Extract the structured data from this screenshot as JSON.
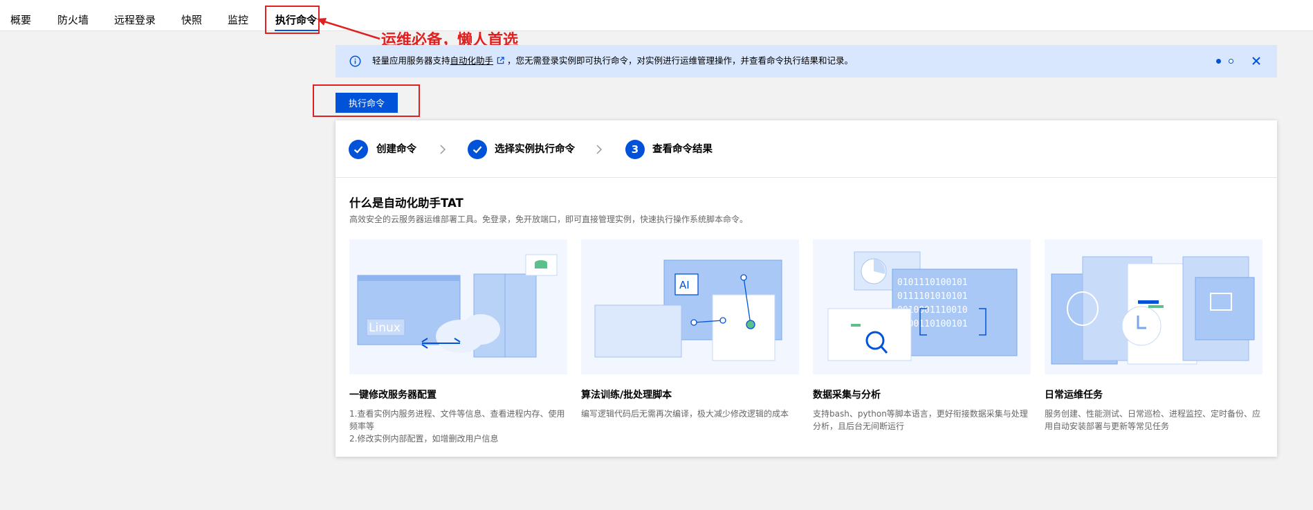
{
  "tabs": [
    {
      "label": "概要"
    },
    {
      "label": "防火墙"
    },
    {
      "label": "远程登录"
    },
    {
      "label": "快照"
    },
    {
      "label": "监控"
    },
    {
      "label": "执行命令"
    }
  ],
  "annotation": {
    "text": "运维必备，懒人首选"
  },
  "banner": {
    "text_before": "轻量应用服务器支持",
    "link_text": "自动化助手",
    "text_after": "，您无需登录实例即可执行命令，对实例进行运维管理操作，并查看命令执行结果和记录。"
  },
  "exec_button": {
    "label": "执行命令"
  },
  "steps": [
    {
      "label": "创建命令",
      "status": "done"
    },
    {
      "label": "选择实例执行命令",
      "status": "done"
    },
    {
      "label": "查看命令结果",
      "number": "3",
      "status": "current"
    }
  ],
  "section": {
    "title": "什么是自动化助手TAT",
    "desc": "高效安全的云服务器运维部署工具。免登录，免开放端口，即可直接管理实例，快速执行操作系统脚本命令。"
  },
  "features": [
    {
      "title": "一键修改服务器配置",
      "desc_lines": [
        "1.查看实例内服务进程、文件等信息、查看进程内存、使用频率等",
        "2.修改实例内部配置，如增删改用户信息"
      ],
      "illustration_text": "Linux"
    },
    {
      "title": "算法训练/批处理脚本",
      "desc_lines": [
        "编写逻辑代码后无需再次编译，极大减少修改逻辑的成本"
      ],
      "illustration_text": "AI"
    },
    {
      "title": "数据采集与分析",
      "desc_lines": [
        "支持bash、python等脚本语言，更好衔接数据采集与处理分析，且后台无间断运行"
      ],
      "illustration_text": [
        "0101110100101",
        "0111101010101",
        "0010001110010",
        "0100110100101"
      ]
    },
    {
      "title": "日常运维任务",
      "desc_lines": [
        "服务创建、性能测试、日常巡检、进程监控、定时备份、应用自动安装部署与更新等常见任务"
      ]
    }
  ],
  "colors": {
    "primary": "#0052d9",
    "annotation_red": "#e02020",
    "banner_bg": "#d8e7fd"
  }
}
